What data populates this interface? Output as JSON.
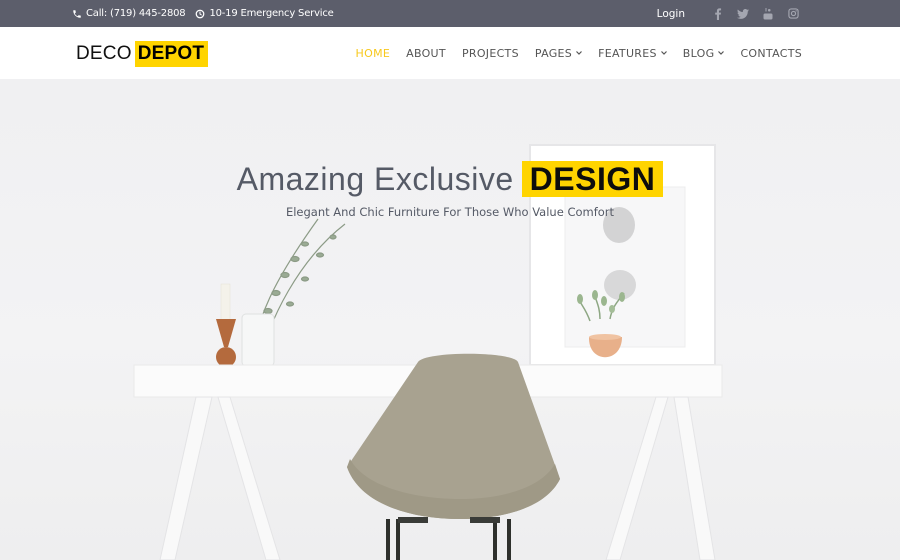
{
  "topbar": {
    "phone": "Call: (719) 445-2808",
    "hours": "10-19 Emergency Service",
    "login": "Login",
    "social": [
      "facebook",
      "twitter",
      "youtube",
      "instagram"
    ]
  },
  "header": {
    "logo": {
      "part1": "DECO",
      "part2": "DEPOT"
    },
    "nav": [
      {
        "label": "HOME",
        "active": true,
        "dropdown": false
      },
      {
        "label": "ABOUT",
        "active": false,
        "dropdown": false
      },
      {
        "label": "PROJECTS",
        "active": false,
        "dropdown": false
      },
      {
        "label": "PAGES",
        "active": false,
        "dropdown": true
      },
      {
        "label": "FEATURES",
        "active": false,
        "dropdown": true
      },
      {
        "label": "BLOG",
        "active": false,
        "dropdown": true
      },
      {
        "label": "CONTACTS",
        "active": false,
        "dropdown": false
      }
    ],
    "caret": "⌄"
  },
  "hero": {
    "title_plain": "Amazing Exclusive",
    "title_highlight": "DESIGN",
    "subtitle": "Elegant And Chic Furniture For Those Who Value Comfort"
  },
  "colors": {
    "accent": "#ffd400",
    "nav_active": "#f7c81d",
    "topbar_bg": "#5c5e6b",
    "text": "#555a66"
  }
}
